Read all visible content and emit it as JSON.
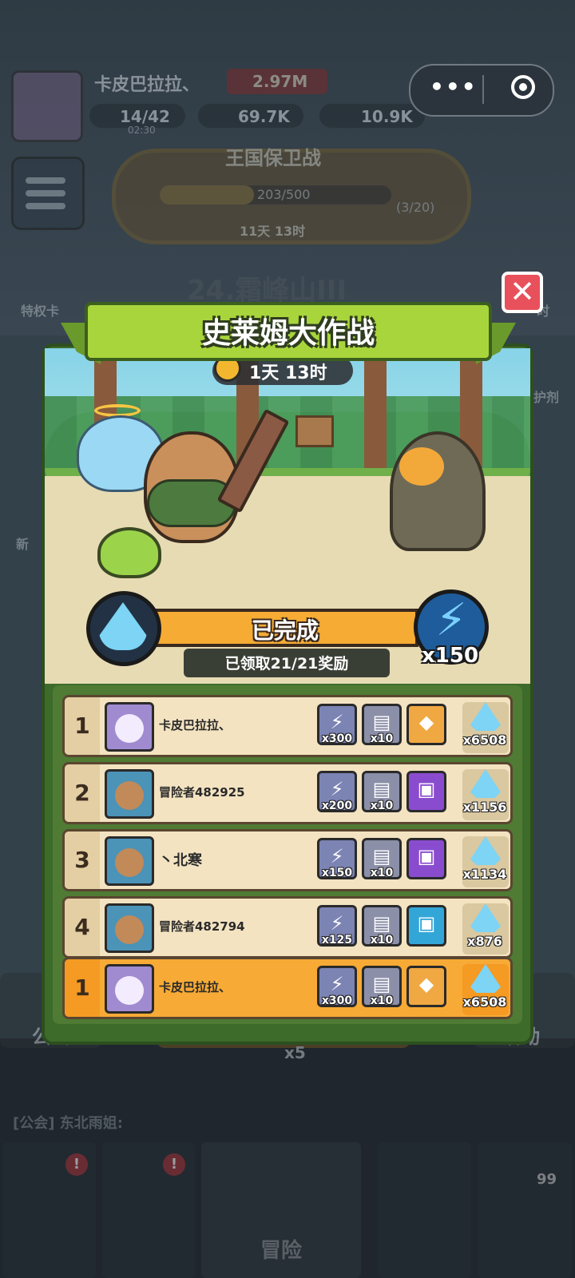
{
  "header": {
    "player_name": "卡皮巴拉拉、",
    "power": "2.97M",
    "energy": "14/42",
    "energy_timer": "02:30",
    "gems": "69.7K",
    "gold": "10.9K"
  },
  "kingdom": {
    "title": "王国保卫战",
    "progress_text": "203/500",
    "progress": 0.406,
    "side_text": "(3/20)",
    "timer": "11天 13时"
  },
  "background": {
    "stage": "24.霜峰山III",
    "left_labels": [
      "特权卡",
      "新"
    ],
    "right_labels": [
      "时",
      "护剂"
    ],
    "bottom_left": "公会",
    "bottom_right": "活动",
    "bottom_mid": "x5",
    "chat": "[公会] 东北雨姐:",
    "nav_label": "冒险",
    "nav_badge_count": "99"
  },
  "modal": {
    "title": "史莱姆大作战",
    "timer": "1天 13时",
    "status": "已完成",
    "claimed": "已领取21/21奖励",
    "bolt_count": "x150",
    "close_icon": "close-icon"
  },
  "ranking": [
    {
      "rank": "1",
      "name": "卡皮巴拉拉、",
      "avatar": "king",
      "name_size": "normal",
      "rewards": [
        {
          "icon": "bolt",
          "q": "x300"
        },
        {
          "icon": "chest",
          "q": "x10"
        },
        {
          "icon": "gold-gem-chest",
          "q": ""
        }
      ],
      "drops": "x6508"
    },
    {
      "rank": "2",
      "name": "冒险者482925",
      "avatar": "capy",
      "name_size": "normal",
      "rewards": [
        {
          "icon": "bolt",
          "q": "x200"
        },
        {
          "icon": "chest",
          "q": "x10"
        },
        {
          "icon": "purple-chest",
          "q": ""
        }
      ],
      "drops": "x1156"
    },
    {
      "rank": "3",
      "name": "丶北寒",
      "avatar": "capy",
      "name_size": "big",
      "rewards": [
        {
          "icon": "bolt",
          "q": "x150"
        },
        {
          "icon": "chest",
          "q": "x10"
        },
        {
          "icon": "purple-chest",
          "q": ""
        }
      ],
      "drops": "x1134"
    },
    {
      "rank": "4",
      "name": "冒险者482794",
      "avatar": "capy",
      "name_size": "normal",
      "rewards": [
        {
          "icon": "bolt",
          "q": "x125"
        },
        {
          "icon": "chest",
          "q": "x10"
        },
        {
          "icon": "blue-chest",
          "q": ""
        }
      ],
      "drops": "x876"
    }
  ],
  "my_rank": {
    "rank": "1",
    "name": "卡皮巴拉拉、",
    "rewards": [
      {
        "icon": "bolt",
        "q": "x300"
      },
      {
        "icon": "chest",
        "q": "x10"
      },
      {
        "icon": "gold-gem-chest",
        "q": ""
      }
    ],
    "drops": "x6508"
  },
  "colors": {
    "modal_green": "#3d6b2a",
    "ribbon": "#a9d53c",
    "progress_orange": "#f5ab34",
    "row_bg": "#f3e3c1",
    "highlight_row": "#f7aa35",
    "close_red": "#e8515b"
  }
}
